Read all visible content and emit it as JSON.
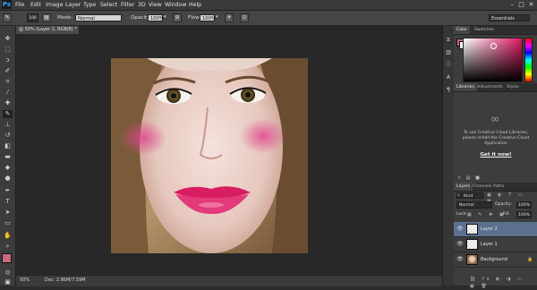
{
  "app": {
    "logo": "Ps"
  },
  "menu": [
    "File",
    "Edit",
    "Image",
    "Layer",
    "Type",
    "Select",
    "Filter",
    "3D",
    "View",
    "Window",
    "Help"
  ],
  "window_buttons": [
    "–",
    "□",
    "✕"
  ],
  "options_bar": {
    "brush_size": "100",
    "mode_label": "Mode:",
    "mode_value": "Normal",
    "opacity_label": "Opacity:",
    "opacity_value": "100%",
    "flow_label": "Flow:",
    "flow_value": "100%",
    "workspace": "Essentials"
  },
  "document": {
    "tab_title": "@ 50% (Layer 2, RGB/8) *",
    "status": "50%",
    "doc_size": "Doc: 2.86M/7.59M"
  },
  "color_panel": {
    "tabs": [
      "Color",
      "Swatches"
    ],
    "active_tab": "Color",
    "foreground_color": "#c9687a",
    "hue_color": "#e01862"
  },
  "libraries_panel": {
    "tabs": [
      "Libraries",
      "Adjustments",
      "Styles"
    ],
    "active_tab": "Libraries",
    "message": "To use Creative Cloud Libraries, please install the Creative Cloud Application",
    "link": "Get it now!"
  },
  "layers_panel": {
    "tabs": [
      "Layers",
      "Channels",
      "Paths"
    ],
    "active_tab": "Layers",
    "filter_label": "Kind",
    "blend_mode": "Normal",
    "opacity_label": "Opacity:",
    "opacity_value": "100%",
    "lock_label": "Lock:",
    "fill_label": "Fill:",
    "fill_value": "100%",
    "layers": [
      {
        "name": "Layer 2",
        "selected": true
      },
      {
        "name": "Layer 1",
        "selected": false
      },
      {
        "name": "Background",
        "selected": false
      }
    ]
  },
  "tools": [
    "move-tool",
    "marquee-tool",
    "lasso-tool",
    "quick-select-tool",
    "crop-tool",
    "eyedropper-tool",
    "healing-tool",
    "brush-tool",
    "clone-stamp-tool",
    "history-brush-tool",
    "eraser-tool",
    "gradient-tool",
    "blur-tool",
    "dodge-tool",
    "pen-tool",
    "type-tool",
    "path-select-tool",
    "rectangle-tool",
    "hand-tool",
    "zoom-tool"
  ]
}
